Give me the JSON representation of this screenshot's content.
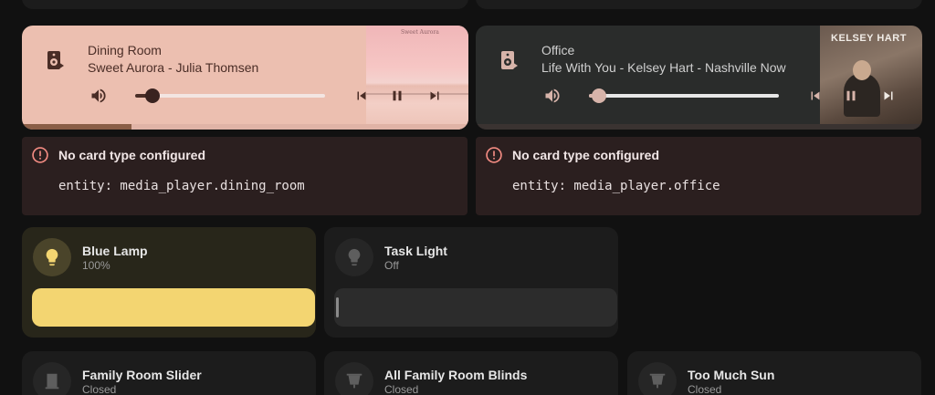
{
  "media_players": [
    {
      "name": "Dining Room",
      "now_playing": "Sweet Aurora - Julia Thomsen",
      "colors": {
        "card": "#ecbfb0",
        "text": "#4a2d26"
      }
    },
    {
      "name": "Office",
      "now_playing": "Life With You - Kelsey Hart - Nashville Now",
      "album_art_text": "KELSEY HART",
      "colors": {
        "card": "#2a2c2b",
        "text": "#cfcfcf"
      }
    }
  ],
  "errors": [
    {
      "title": "No card type configured",
      "entity": "entity: media_player.dining_room"
    },
    {
      "title": "No card type configured",
      "entity": "entity: media_player.office"
    }
  ],
  "lights": [
    {
      "name": "Blue Lamp",
      "state": "100%",
      "icon": "lightbulb-icon",
      "on": true,
      "brightness": 1.0,
      "color": "#f3d571"
    },
    {
      "name": "Task Light",
      "state": "Off",
      "icon": "lightbulb-icon",
      "on": false,
      "brightness": 0
    }
  ],
  "covers": [
    {
      "name": "Family Room Slider",
      "state": "Closed",
      "icon": "door-closed-icon"
    },
    {
      "name": "All Family Room Blinds",
      "state": "Closed",
      "icon": "blinds-icon"
    },
    {
      "name": "Too Much Sun",
      "state": "Closed",
      "icon": "blinds-icon"
    }
  ]
}
